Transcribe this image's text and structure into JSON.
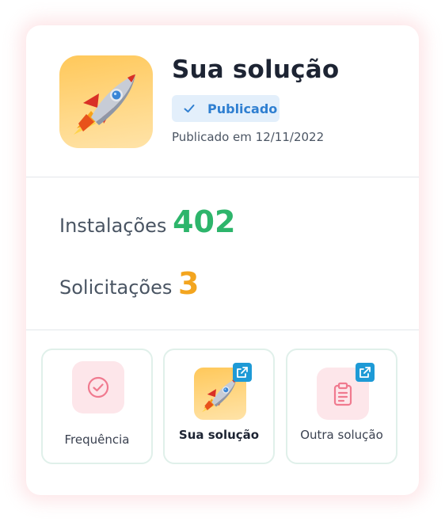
{
  "solution": {
    "title": "Sua solução",
    "status": "Publicado",
    "published_date": "Publicado em 12/11/2022",
    "icon": "rocket-icon"
  },
  "stats": {
    "installs_label": "Instalações",
    "installs_value": "402",
    "requests_label": "Solicitações",
    "requests_value": "3"
  },
  "tiles": [
    {
      "label": "Frequência",
      "icon": "check-circle-icon"
    },
    {
      "label": "Sua solução",
      "icon": "rocket-icon",
      "external": "external-link-icon"
    },
    {
      "label": "Outra solução",
      "icon": "clipboard-icon",
      "external": "external-link-icon"
    }
  ],
  "colors": {
    "installs": "#2db56b",
    "requests": "#f3a51f",
    "status_badge_bg": "#e3effb",
    "status_badge_text": "#2f7fd1",
    "tile_icon_bg": "#fde6ea",
    "external_badge": "#1e9ad6"
  }
}
